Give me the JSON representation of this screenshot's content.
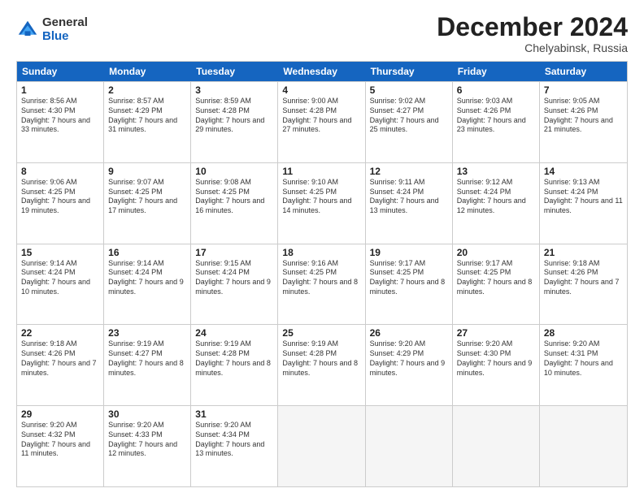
{
  "logo": {
    "general": "General",
    "blue": "Blue"
  },
  "title": "December 2024",
  "subtitle": "Chelyabinsk, Russia",
  "headers": [
    "Sunday",
    "Monday",
    "Tuesday",
    "Wednesday",
    "Thursday",
    "Friday",
    "Saturday"
  ],
  "weeks": [
    [
      {
        "day": "1",
        "sunrise": "Sunrise: 8:56 AM",
        "sunset": "Sunset: 4:30 PM",
        "daylight": "Daylight: 7 hours and 33 minutes."
      },
      {
        "day": "2",
        "sunrise": "Sunrise: 8:57 AM",
        "sunset": "Sunset: 4:29 PM",
        "daylight": "Daylight: 7 hours and 31 minutes."
      },
      {
        "day": "3",
        "sunrise": "Sunrise: 8:59 AM",
        "sunset": "Sunset: 4:28 PM",
        "daylight": "Daylight: 7 hours and 29 minutes."
      },
      {
        "day": "4",
        "sunrise": "Sunrise: 9:00 AM",
        "sunset": "Sunset: 4:28 PM",
        "daylight": "Daylight: 7 hours and 27 minutes."
      },
      {
        "day": "5",
        "sunrise": "Sunrise: 9:02 AM",
        "sunset": "Sunset: 4:27 PM",
        "daylight": "Daylight: 7 hours and 25 minutes."
      },
      {
        "day": "6",
        "sunrise": "Sunrise: 9:03 AM",
        "sunset": "Sunset: 4:26 PM",
        "daylight": "Daylight: 7 hours and 23 minutes."
      },
      {
        "day": "7",
        "sunrise": "Sunrise: 9:05 AM",
        "sunset": "Sunset: 4:26 PM",
        "daylight": "Daylight: 7 hours and 21 minutes."
      }
    ],
    [
      {
        "day": "8",
        "sunrise": "Sunrise: 9:06 AM",
        "sunset": "Sunset: 4:25 PM",
        "daylight": "Daylight: 7 hours and 19 minutes."
      },
      {
        "day": "9",
        "sunrise": "Sunrise: 9:07 AM",
        "sunset": "Sunset: 4:25 PM",
        "daylight": "Daylight: 7 hours and 17 minutes."
      },
      {
        "day": "10",
        "sunrise": "Sunrise: 9:08 AM",
        "sunset": "Sunset: 4:25 PM",
        "daylight": "Daylight: 7 hours and 16 minutes."
      },
      {
        "day": "11",
        "sunrise": "Sunrise: 9:10 AM",
        "sunset": "Sunset: 4:25 PM",
        "daylight": "Daylight: 7 hours and 14 minutes."
      },
      {
        "day": "12",
        "sunrise": "Sunrise: 9:11 AM",
        "sunset": "Sunset: 4:24 PM",
        "daylight": "Daylight: 7 hours and 13 minutes."
      },
      {
        "day": "13",
        "sunrise": "Sunrise: 9:12 AM",
        "sunset": "Sunset: 4:24 PM",
        "daylight": "Daylight: 7 hours and 12 minutes."
      },
      {
        "day": "14",
        "sunrise": "Sunrise: 9:13 AM",
        "sunset": "Sunset: 4:24 PM",
        "daylight": "Daylight: 7 hours and 11 minutes."
      }
    ],
    [
      {
        "day": "15",
        "sunrise": "Sunrise: 9:14 AM",
        "sunset": "Sunset: 4:24 PM",
        "daylight": "Daylight: 7 hours and 10 minutes."
      },
      {
        "day": "16",
        "sunrise": "Sunrise: 9:14 AM",
        "sunset": "Sunset: 4:24 PM",
        "daylight": "Daylight: 7 hours and 9 minutes."
      },
      {
        "day": "17",
        "sunrise": "Sunrise: 9:15 AM",
        "sunset": "Sunset: 4:24 PM",
        "daylight": "Daylight: 7 hours and 9 minutes."
      },
      {
        "day": "18",
        "sunrise": "Sunrise: 9:16 AM",
        "sunset": "Sunset: 4:25 PM",
        "daylight": "Daylight: 7 hours and 8 minutes."
      },
      {
        "day": "19",
        "sunrise": "Sunrise: 9:17 AM",
        "sunset": "Sunset: 4:25 PM",
        "daylight": "Daylight: 7 hours and 8 minutes."
      },
      {
        "day": "20",
        "sunrise": "Sunrise: 9:17 AM",
        "sunset": "Sunset: 4:25 PM",
        "daylight": "Daylight: 7 hours and 8 minutes."
      },
      {
        "day": "21",
        "sunrise": "Sunrise: 9:18 AM",
        "sunset": "Sunset: 4:26 PM",
        "daylight": "Daylight: 7 hours and 7 minutes."
      }
    ],
    [
      {
        "day": "22",
        "sunrise": "Sunrise: 9:18 AM",
        "sunset": "Sunset: 4:26 PM",
        "daylight": "Daylight: 7 hours and 7 minutes."
      },
      {
        "day": "23",
        "sunrise": "Sunrise: 9:19 AM",
        "sunset": "Sunset: 4:27 PM",
        "daylight": "Daylight: 7 hours and 8 minutes."
      },
      {
        "day": "24",
        "sunrise": "Sunrise: 9:19 AM",
        "sunset": "Sunset: 4:28 PM",
        "daylight": "Daylight: 7 hours and 8 minutes."
      },
      {
        "day": "25",
        "sunrise": "Sunrise: 9:19 AM",
        "sunset": "Sunset: 4:28 PM",
        "daylight": "Daylight: 7 hours and 8 minutes."
      },
      {
        "day": "26",
        "sunrise": "Sunrise: 9:20 AM",
        "sunset": "Sunset: 4:29 PM",
        "daylight": "Daylight: 7 hours and 9 minutes."
      },
      {
        "day": "27",
        "sunrise": "Sunrise: 9:20 AM",
        "sunset": "Sunset: 4:30 PM",
        "daylight": "Daylight: 7 hours and 9 minutes."
      },
      {
        "day": "28",
        "sunrise": "Sunrise: 9:20 AM",
        "sunset": "Sunset: 4:31 PM",
        "daylight": "Daylight: 7 hours and 10 minutes."
      }
    ],
    [
      {
        "day": "29",
        "sunrise": "Sunrise: 9:20 AM",
        "sunset": "Sunset: 4:32 PM",
        "daylight": "Daylight: 7 hours and 11 minutes."
      },
      {
        "day": "30",
        "sunrise": "Sunrise: 9:20 AM",
        "sunset": "Sunset: 4:33 PM",
        "daylight": "Daylight: 7 hours and 12 minutes."
      },
      {
        "day": "31",
        "sunrise": "Sunrise: 9:20 AM",
        "sunset": "Sunset: 4:34 PM",
        "daylight": "Daylight: 7 hours and 13 minutes."
      },
      null,
      null,
      null,
      null
    ]
  ]
}
